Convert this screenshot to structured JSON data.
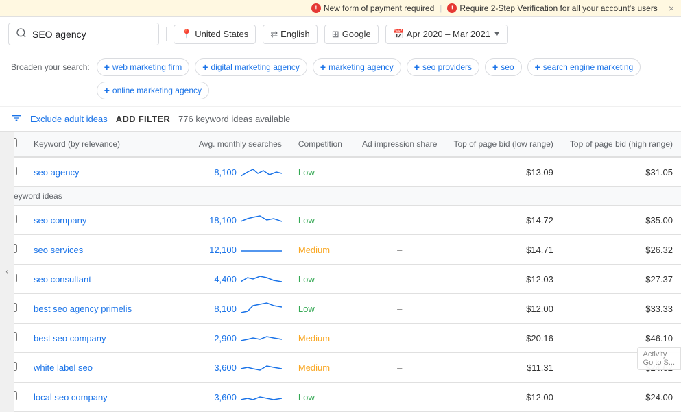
{
  "notif": {
    "item1": "New form of payment required",
    "item2": "Require 2-Step Verification for all your account's users",
    "close_label": "×"
  },
  "header": {
    "search_value": "SEO agency",
    "location": "United States",
    "language": "English",
    "engine": "Google",
    "date_range": "Apr 2020 – Mar 2021"
  },
  "broaden": {
    "label": "Broaden your search:",
    "chips": [
      "web marketing firm",
      "digital marketing agency",
      "marketing agency",
      "seo providers",
      "seo",
      "search engine marketing",
      "online marketing agency"
    ]
  },
  "filter_bar": {
    "exclude_label": "Exclude adult ideas",
    "add_filter_label": "ADD FILTER",
    "count_label": "776 keyword ideas available"
  },
  "table": {
    "headers": {
      "keyword": "Keyword (by relevance)",
      "avg": "Avg. monthly searches",
      "competition": "Competition",
      "ad_impression": "Ad impression share",
      "bid_low": "Top of page bid (low range)",
      "bid_high": "Top of page bid (high range)"
    },
    "main_keyword": {
      "text": "seo agency",
      "avg": "8,100",
      "competition": "Low",
      "ad_impression": "–",
      "bid_low": "$13.09",
      "bid_high": "$31.05"
    },
    "section_label": "Keyword ideas",
    "ideas": [
      {
        "keyword": "seo company",
        "avg": "18,100",
        "competition": "Low",
        "comp_class": "comp-low",
        "ad_impression": "–",
        "bid_low": "$14.72",
        "bid_high": "$35.00"
      },
      {
        "keyword": "seo services",
        "avg": "12,100",
        "competition": "Medium",
        "comp_class": "comp-medium",
        "ad_impression": "–",
        "bid_low": "$14.71",
        "bid_high": "$26.32"
      },
      {
        "keyword": "seo consultant",
        "avg": "4,400",
        "competition": "Low",
        "comp_class": "comp-low",
        "ad_impression": "–",
        "bid_low": "$12.03",
        "bid_high": "$27.37"
      },
      {
        "keyword": "best seo agency primelis",
        "avg": "8,100",
        "competition": "Low",
        "comp_class": "comp-low",
        "ad_impression": "–",
        "bid_low": "$12.00",
        "bid_high": "$33.33"
      },
      {
        "keyword": "best seo company",
        "avg": "2,900",
        "competition": "Medium",
        "comp_class": "comp-medium",
        "ad_impression": "–",
        "bid_low": "$20.16",
        "bid_high": "$46.10"
      },
      {
        "keyword": "white label seo",
        "avg": "3,600",
        "competition": "Medium",
        "comp_class": "comp-medium",
        "ad_impression": "–",
        "bid_low": "$11.31",
        "bid_high": "$24.62"
      },
      {
        "keyword": "local seo company",
        "avg": "3,600",
        "competition": "Low",
        "comp_class": "comp-low",
        "ad_impression": "–",
        "bid_low": "$12.00",
        "bid_high": "$24.00"
      }
    ]
  },
  "activity_hint": "Activity\nGo to S..."
}
